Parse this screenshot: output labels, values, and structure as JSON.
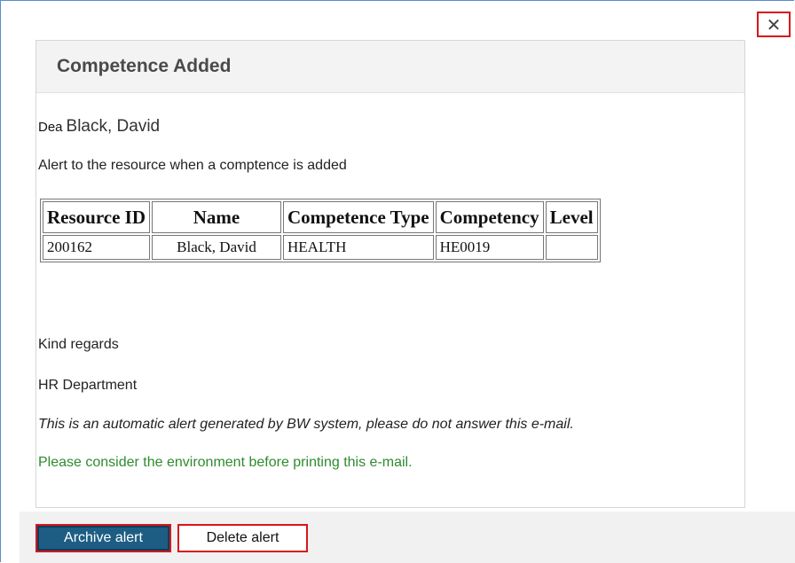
{
  "window": {
    "close_glyph": "✕"
  },
  "dialog": {
    "title": "Competence Added",
    "salutation": "Dea",
    "recipient_name": "Black, David",
    "alert_description": "Alert to the resource when a comptence is added",
    "table": {
      "headers": [
        "Resource ID",
        "Name",
        "Competence Type",
        "Competency",
        "Level"
      ],
      "rows": [
        [
          "200162",
          "Black, David",
          "HEALTH",
          "HE0019",
          ""
        ]
      ]
    },
    "closing": "Kind regards",
    "department": "HR Department",
    "auto_note": "This is an automatic alert generated by BW system, please do not answer this e-mail.",
    "environment_note": "Please consider the environment before printing this e-mail."
  },
  "footer": {
    "archive_label": "Archive alert",
    "delete_label": "Delete alert"
  },
  "colors": {
    "highlight_border": "#d9151b",
    "primary_button": "#1d5d84",
    "environment_text": "#2e8b2e"
  }
}
